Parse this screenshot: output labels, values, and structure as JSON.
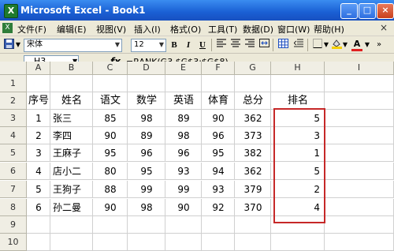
{
  "window": {
    "app_icon": "X",
    "title": "Microsoft Excel - Book1",
    "buttons": [
      "_",
      "□",
      "×"
    ]
  },
  "menu": {
    "doc_icon": "X",
    "items": [
      "文件(F)",
      "编辑(E)",
      "视图(V)",
      "插入(I)",
      "格式(O)",
      "工具(T)",
      "数据(D)",
      "窗口(W)",
      "帮助(H)"
    ],
    "close_doc": "×"
  },
  "toolbar": {
    "font_name": "宋体",
    "font_size": "12",
    "bold": "B",
    "italic": "I",
    "underline": "U",
    "font_color_label": "A"
  },
  "formula_bar": {
    "name_box": "H3",
    "fx": "fx",
    "formula": "=RANK(G3,$G$3:$G$8)"
  },
  "grid": {
    "columns": [
      "A",
      "B",
      "C",
      "D",
      "E",
      "F",
      "G",
      "H",
      "I"
    ],
    "row_numbers": [
      "1",
      "2",
      "3",
      "4",
      "5",
      "6",
      "7",
      "8",
      "9",
      "10"
    ],
    "headers": [
      "序号",
      "姓名",
      "语文",
      "数学",
      "英语",
      "体育",
      "总分",
      "排名"
    ],
    "rows": [
      [
        "1",
        "张三",
        "85",
        "98",
        "89",
        "90",
        "362",
        "5"
      ],
      [
        "2",
        "李四",
        "90",
        "89",
        "98",
        "96",
        "373",
        "3"
      ],
      [
        "3",
        "王麻子",
        "95",
        "96",
        "96",
        "95",
        "382",
        "1"
      ],
      [
        "4",
        "店小二",
        "80",
        "95",
        "93",
        "94",
        "362",
        "5"
      ],
      [
        "5",
        "王狗子",
        "88",
        "99",
        "99",
        "93",
        "379",
        "2"
      ],
      [
        "6",
        "孙二曼",
        "90",
        "98",
        "90",
        "92",
        "370",
        "4"
      ]
    ]
  },
  "colors": {
    "title_bar": "#1a5fd4",
    "chrome": "#ece9d8",
    "highlight_box": "#c62828"
  }
}
